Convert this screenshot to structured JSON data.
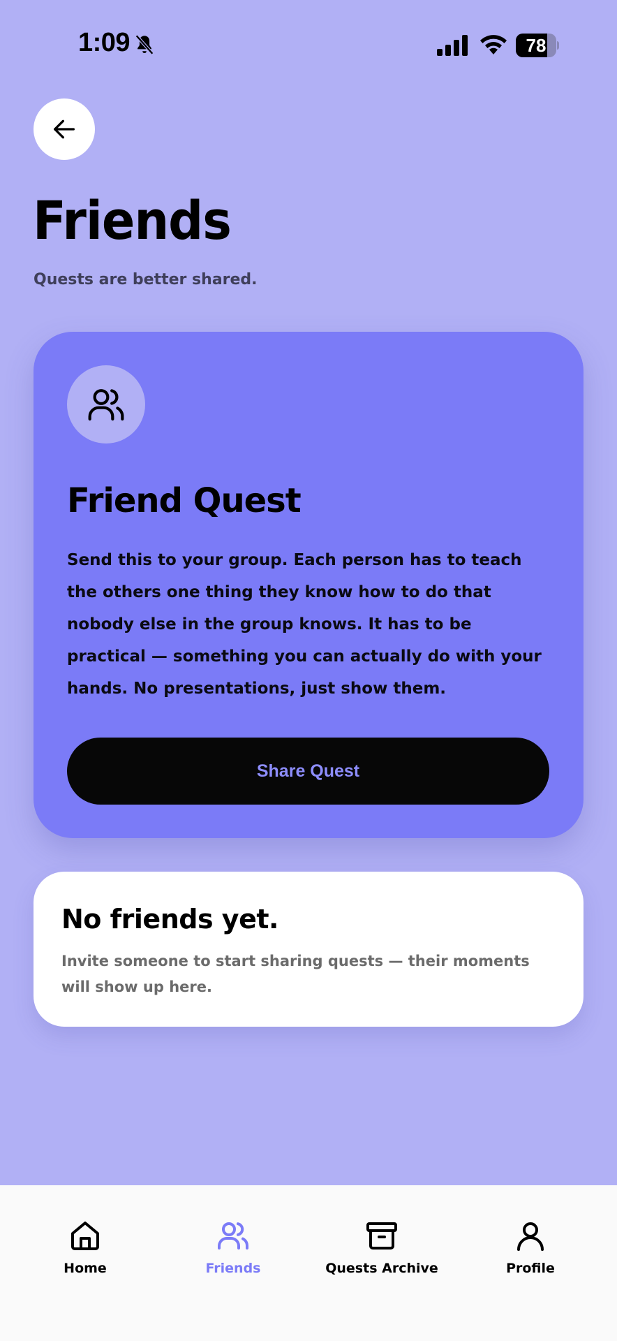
{
  "status_bar": {
    "time": "1:09",
    "battery_percent": 78
  },
  "header": {
    "title": "Friends",
    "subtitle": "Quests are better shared."
  },
  "quest_card": {
    "title": "Friend Quest",
    "description": "Send this to your group. Each person has to teach the others one thing they know how to do that nobody else in the group knows. It has to be practical — something you can actually do with your hands. No presentations, just show them.",
    "button_label": "Share Quest"
  },
  "empty_state": {
    "title": "No friends yet.",
    "message": "Invite someone to start sharing quests — their moments will show up here."
  },
  "bottom_nav": {
    "items": [
      {
        "label": "Home",
        "icon": "home-icon",
        "active": false
      },
      {
        "label": "Friends",
        "icon": "friends-icon",
        "active": true
      },
      {
        "label": "Quests Archive",
        "icon": "archive-icon",
        "active": false
      },
      {
        "label": "Profile",
        "icon": "profile-icon",
        "active": false
      }
    ]
  },
  "colors": {
    "background": "#b1b0f5",
    "accent": "#7b7bf7",
    "button_dark": "#070707"
  }
}
